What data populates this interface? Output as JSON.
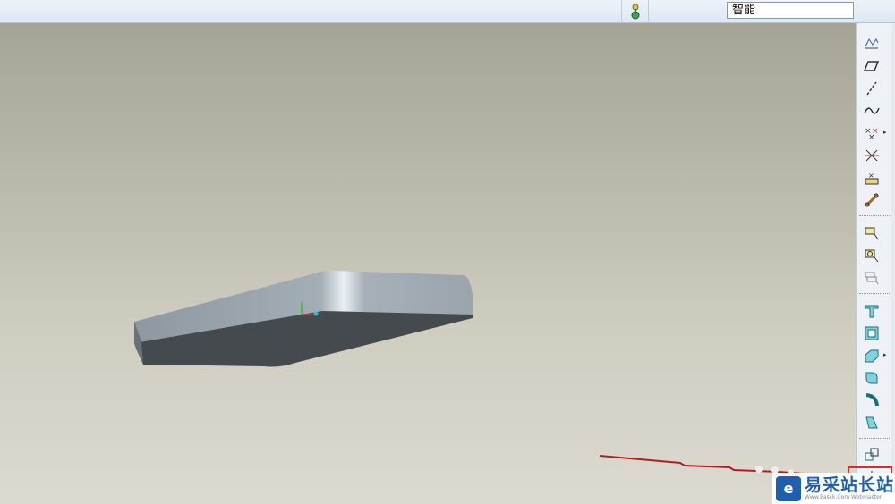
{
  "topbar": {
    "filter_value": "智能"
  },
  "toolbar": {
    "groups": [
      [
        "datum-plane-icon",
        "plane-icon",
        "axis-icon",
        "curve-icon",
        "point-icon",
        "csys-icon",
        "analysis-icon",
        "sketch-link-icon"
      ],
      [
        "extrude-icon",
        "revolve-icon",
        "sweep-icon"
      ],
      [
        "hole-icon",
        "shell-icon",
        "rib-icon",
        "round-icon",
        "chamfer-icon",
        "draft-icon"
      ],
      [
        "pattern-icon",
        "mirror-icon"
      ]
    ]
  },
  "watermark": {
    "logo_letter": "e",
    "title": "易采站长站",
    "subtitle": "Www.Easck.Com Webmaster"
  },
  "colors": {
    "highlight": "#d43030",
    "brand": "#1f5fb0"
  }
}
